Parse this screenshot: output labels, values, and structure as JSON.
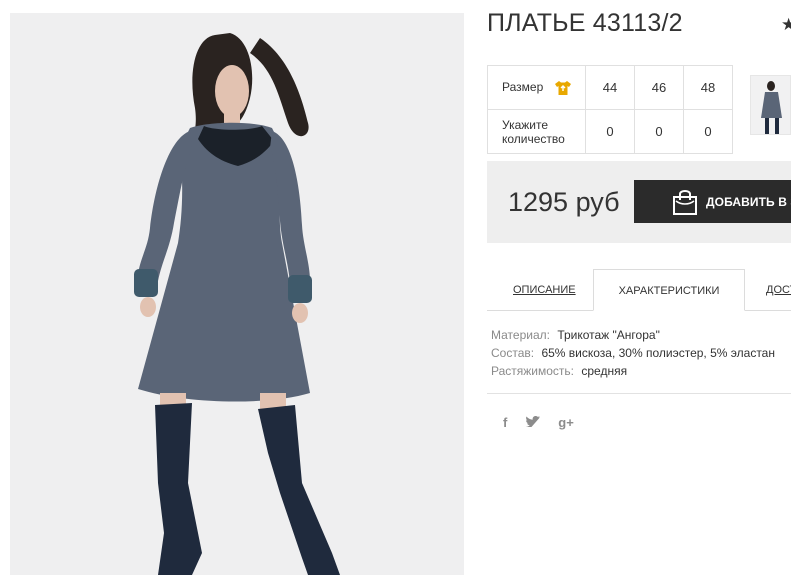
{
  "product": {
    "title": "ПЛАТЬЕ 43113/2",
    "favorite_icon": "star-icon"
  },
  "size_table": {
    "size_label": "Размер",
    "size_icon": "tshirt-icon",
    "sizes": [
      "44",
      "46",
      "48"
    ],
    "qty_label_line1": "Укажите",
    "qty_label_line2": "количество",
    "quantities": [
      "0",
      "0",
      "0"
    ]
  },
  "buy": {
    "price": "1295 руб",
    "add_button_label": "ДОБАВИТЬ В ЗАКАЗ",
    "add_button_icon": "shopping-bag-icon"
  },
  "tabs": [
    {
      "label": "ОПИСАНИЕ",
      "active": false
    },
    {
      "label": "ХАРАКТЕРИСТИКИ",
      "active": true
    },
    {
      "label": "ДОСТАВКА",
      "active": false
    }
  ],
  "specs": [
    {
      "key": "Материал:",
      "value": "Трикотаж \"Ангора\""
    },
    {
      "key": "Состав:",
      "value": "65% вискоза, 30% полиэстер, 5% эластан"
    },
    {
      "key": "Растяжимость:",
      "value": "средняя"
    }
  ],
  "social": [
    {
      "icon": "facebook-icon",
      "glyph": "f"
    },
    {
      "icon": "twitter-icon",
      "glyph": "t"
    },
    {
      "icon": "google-plus-icon",
      "glyph": "g+"
    }
  ],
  "colors": {
    "dress": "#5a6577",
    "boots": "#1f2a3d",
    "button_bg": "#2b2b2b",
    "accent_icon": "#e8a800"
  }
}
